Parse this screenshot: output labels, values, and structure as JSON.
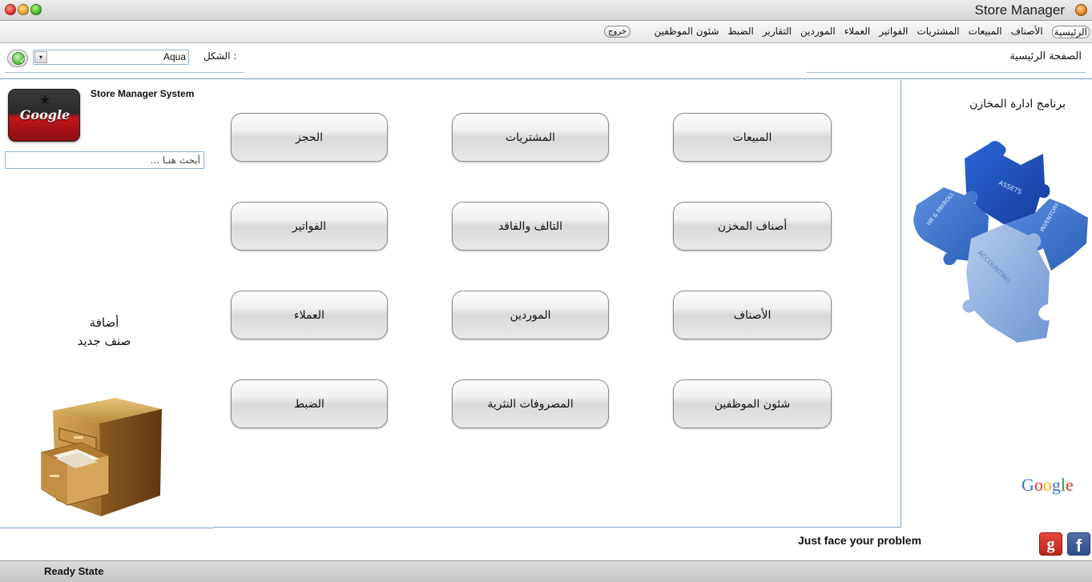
{
  "window": {
    "title": "Store Manager"
  },
  "menu": {
    "items": [
      "الرئيسية",
      "الأصناف",
      "المبيعات",
      "المشتريات",
      "الفواتير",
      "العملاء",
      "الموردين",
      "التقارير",
      "الضبط",
      "شئون الموظفين"
    ],
    "active_index": 0,
    "exit_label": "خروج"
  },
  "toolbar": {
    "theme_label": "الشكل :",
    "theme_value": "Aqua",
    "page_title": "الصفحة الرئيسية"
  },
  "left_panel": {
    "icon_text": "Google",
    "system_title": "Store Manager System",
    "search_placeholder": "أبحث هنـا ...",
    "add_label_line1": "أضافة",
    "add_label_line2": "صنف جديد"
  },
  "buttons": {
    "sales": "المبيعات",
    "purchases": "المشتريات",
    "booking": "الحجز",
    "store_items": "أصناف المخزن",
    "damaged_lost": "التالف والفاقد",
    "invoices": "الفواتير",
    "categories": "الأصناف",
    "suppliers": "الموردين",
    "customers": "العملاء",
    "employees": "شئون الموظفين",
    "expenses": "المصروفات النثرية",
    "settings": "الضبط"
  },
  "right_panel": {
    "title": "برنامج ادارة المخازن",
    "puzzle_labels": [
      "INVENTORY",
      "HR & PAYROLL",
      "ACCOUNTING"
    ],
    "google_logo": "Google"
  },
  "footer": {
    "tagline": "Just face your problem",
    "gplus_label": "g",
    "facebook_label": "f"
  },
  "status": {
    "text": "Ready State"
  },
  "colors": {
    "border_blue": "#7aa0c8",
    "puzzle_dark": "#1f4fb8",
    "puzzle_mid": "#3f76d6",
    "puzzle_light": "#8fb0e4"
  }
}
